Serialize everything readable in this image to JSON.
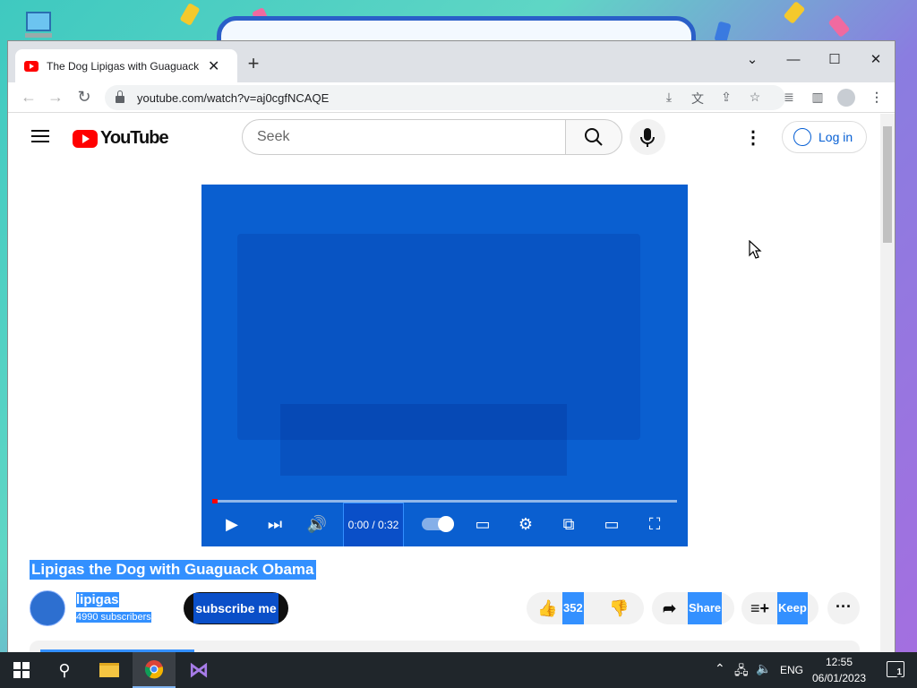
{
  "browser": {
    "tab_title": "The Dog Lipigas with Guaguack O",
    "url": "youtube.com/watch?v=aj0cgfNCAQE"
  },
  "youtube": {
    "logo_text": "YouTube",
    "search_placeholder": "Seek",
    "login_label": "Log in"
  },
  "video": {
    "time": "0:00 / 0:32",
    "progress": 0.0,
    "title": "Lipigas the Dog with Guaguack Obama"
  },
  "channel": {
    "name": "lipigas",
    "subscribers": "4990 subscribers",
    "subscribe_label": "subscribe me"
  },
  "actions": {
    "likes": "352",
    "share": "Share",
    "keep": "Keep"
  },
  "taskbar": {
    "lang": "ENG",
    "time": "12:55",
    "date": "06/01/2023",
    "notifications": "1"
  },
  "colors": {
    "selection": "#3390ff",
    "yt_red": "#ff0000",
    "player_tint": "#0a5fd0"
  }
}
